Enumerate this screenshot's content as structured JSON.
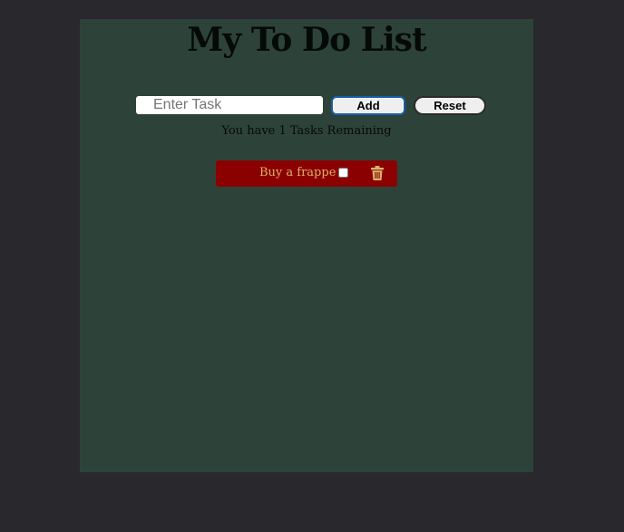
{
  "header": {
    "title": "My To Do List"
  },
  "form": {
    "input_placeholder": "Enter Task",
    "input_value": "",
    "add_label": "Add",
    "reset_label": "Reset"
  },
  "status": {
    "remaining_text": "You have 1 Tasks Remaining"
  },
  "tasks": [
    {
      "text": "Buy a frappe",
      "checked": false,
      "delete_icon": "trash-icon"
    }
  ],
  "colors": {
    "page_background": "#29282d",
    "app_background": "#2d4339",
    "task_background": "#8b0000",
    "task_text": "#d9b36a",
    "title_text": "#050a08"
  }
}
